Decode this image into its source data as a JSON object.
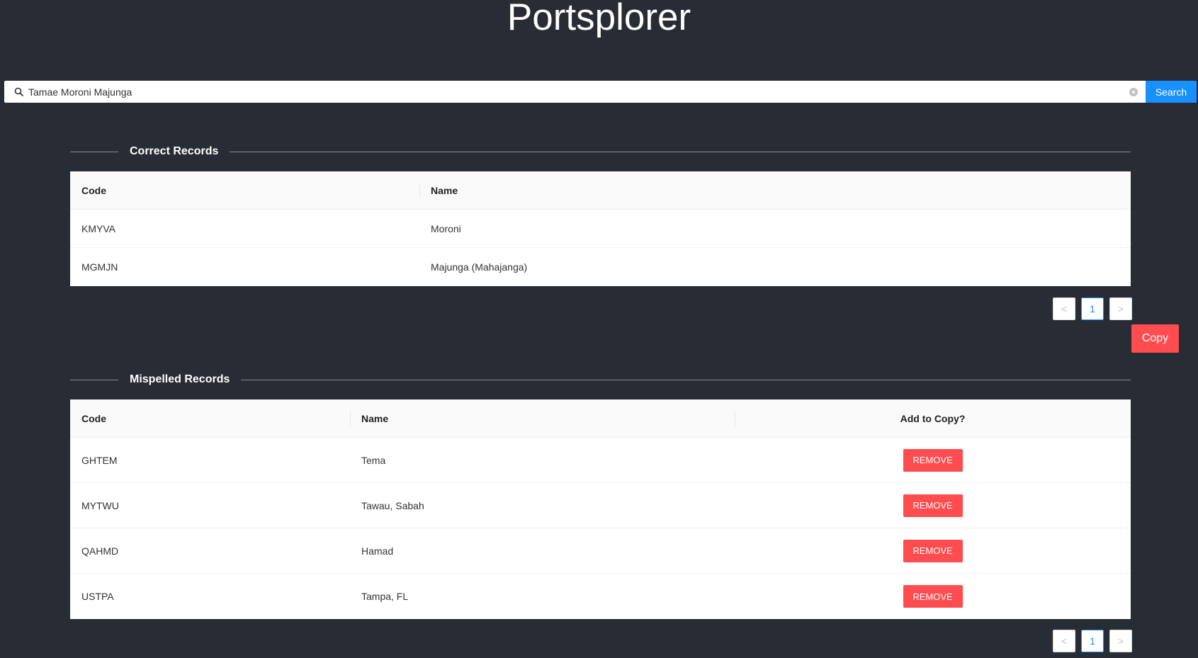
{
  "app": {
    "title": "Portsplorer"
  },
  "search": {
    "value": "Tamae Moroni Majunga",
    "button_label": "Search"
  },
  "correct": {
    "title": "Correct Records",
    "columns": [
      "Code",
      "Name"
    ],
    "rows": [
      {
        "code": "KMYVA",
        "name": "Moroni"
      },
      {
        "code": "MGMJN",
        "name": "Majunga (Mahajanga)"
      }
    ],
    "pagination": {
      "page": "1",
      "prev": "<",
      "next": ">"
    }
  },
  "copy_label": "Copy",
  "misspelled": {
    "title": "Mispelled Records",
    "columns": [
      "Code",
      "Name",
      "Add to Copy?"
    ],
    "rows": [
      {
        "code": "GHTEM",
        "name": "Tema",
        "action": "REMOVE"
      },
      {
        "code": "MYTWU",
        "name": "Tawau, Sabah",
        "action": "REMOVE"
      },
      {
        "code": "QAHMD",
        "name": "Hamad",
        "action": "REMOVE"
      },
      {
        "code": "USTPA",
        "name": "Tampa, FL",
        "action": "REMOVE"
      }
    ],
    "pagination": {
      "page": "1",
      "prev": "<",
      "next": ">"
    }
  },
  "colors": {
    "background": "#282c34",
    "primary": "#1890ff",
    "danger": "#ff4d4f"
  },
  "icons": {
    "search": "search-icon",
    "clear": "close-circle-icon",
    "prev": "chevron-left-icon",
    "next": "chevron-right-icon"
  }
}
